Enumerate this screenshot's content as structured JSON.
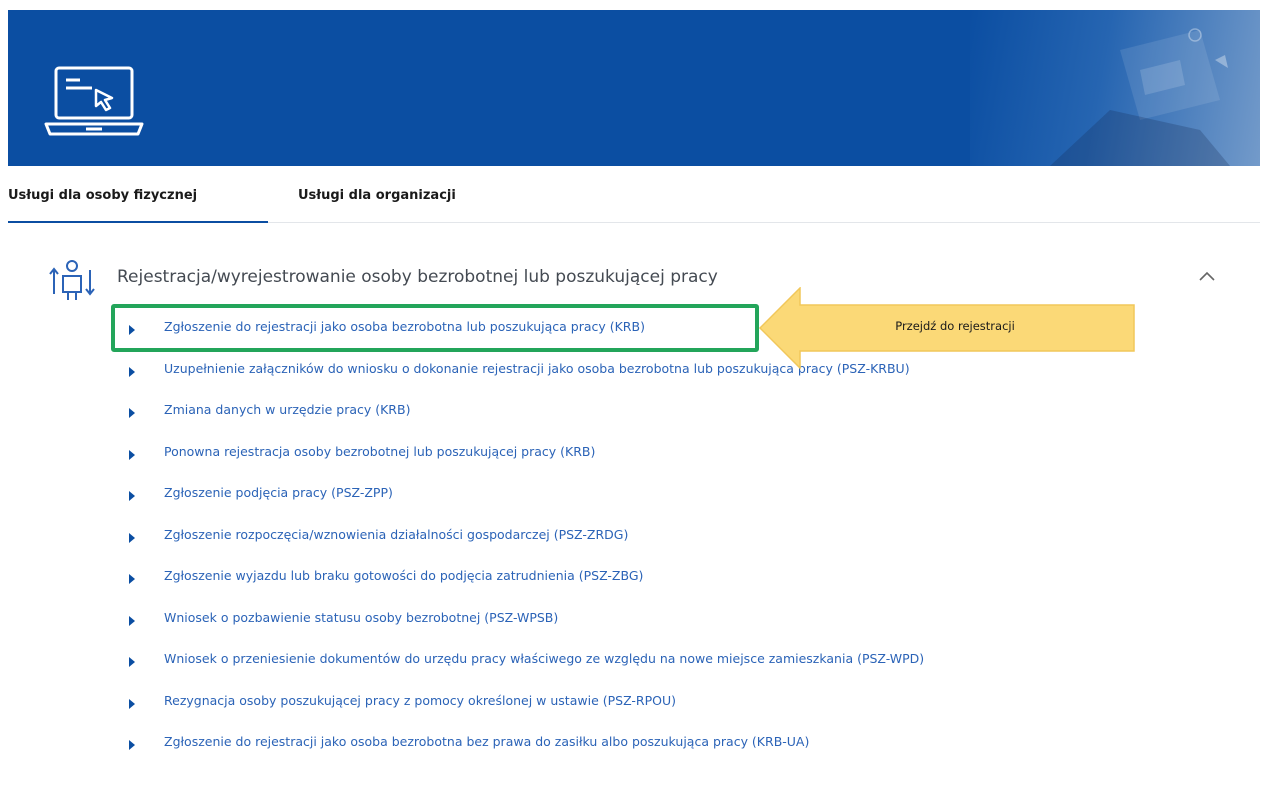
{
  "banner": {
    "icon": "laptop-cursor-icon",
    "color": "#0b4ea2"
  },
  "tabs": [
    {
      "label": "Usługi dla osoby fizycznej",
      "active": true
    },
    {
      "label": "Usługi dla organizacji",
      "active": false
    }
  ],
  "section": {
    "icon": "person-arrows-icon",
    "title": "Rejestracja/wyrejestrowanie osoby bezrobotnej lub poszukującej pracy",
    "collapse_icon": "chevron-up-icon"
  },
  "items": [
    "Zgłoszenie do rejestracji jako osoba bezrobotna lub poszukująca pracy (KRB)",
    "Uzupełnienie załączników do wniosku o dokonanie rejestracji jako osoba bezrobotna lub poszukująca pracy (PSZ-KRBU)",
    "Zmiana danych w urzędzie pracy (KRB)",
    "Ponowna rejestracja osoby bezrobotnej lub poszukującej pracy (KRB)",
    "Zgłoszenie podjęcia pracy (PSZ-ZPP)",
    "Zgłoszenie rozpoczęcia/wznowienia działalności gospodarczej (PSZ-ZRDG)",
    "Zgłoszenie wyjazdu lub braku gotowości do podjęcia zatrudnienia (PSZ-ZBG)",
    "Wniosek o pozbawienie statusu osoby bezrobotnej (PSZ-WPSB)",
    "Wniosek o przeniesienie dokumentów do urzędu pracy właściwego ze względu na nowe miejsce zamieszkania (PSZ-WPD)",
    "Rezygnacja osoby poszukującej pracy z pomocy określonej w ustawie (PSZ-RPOU)",
    "Zgłoszenie do rejestracji jako osoba bezrobotna bez prawa do zasiłku albo poszukująca pracy (KRB-UA)"
  ],
  "annotation": {
    "label": "Przejdź do rejestracji",
    "arrow_color": "#fbd977",
    "highlight_color": "#23a55a"
  },
  "colors": {
    "link": "#2b63b7",
    "accent": "#0b4ea2"
  }
}
